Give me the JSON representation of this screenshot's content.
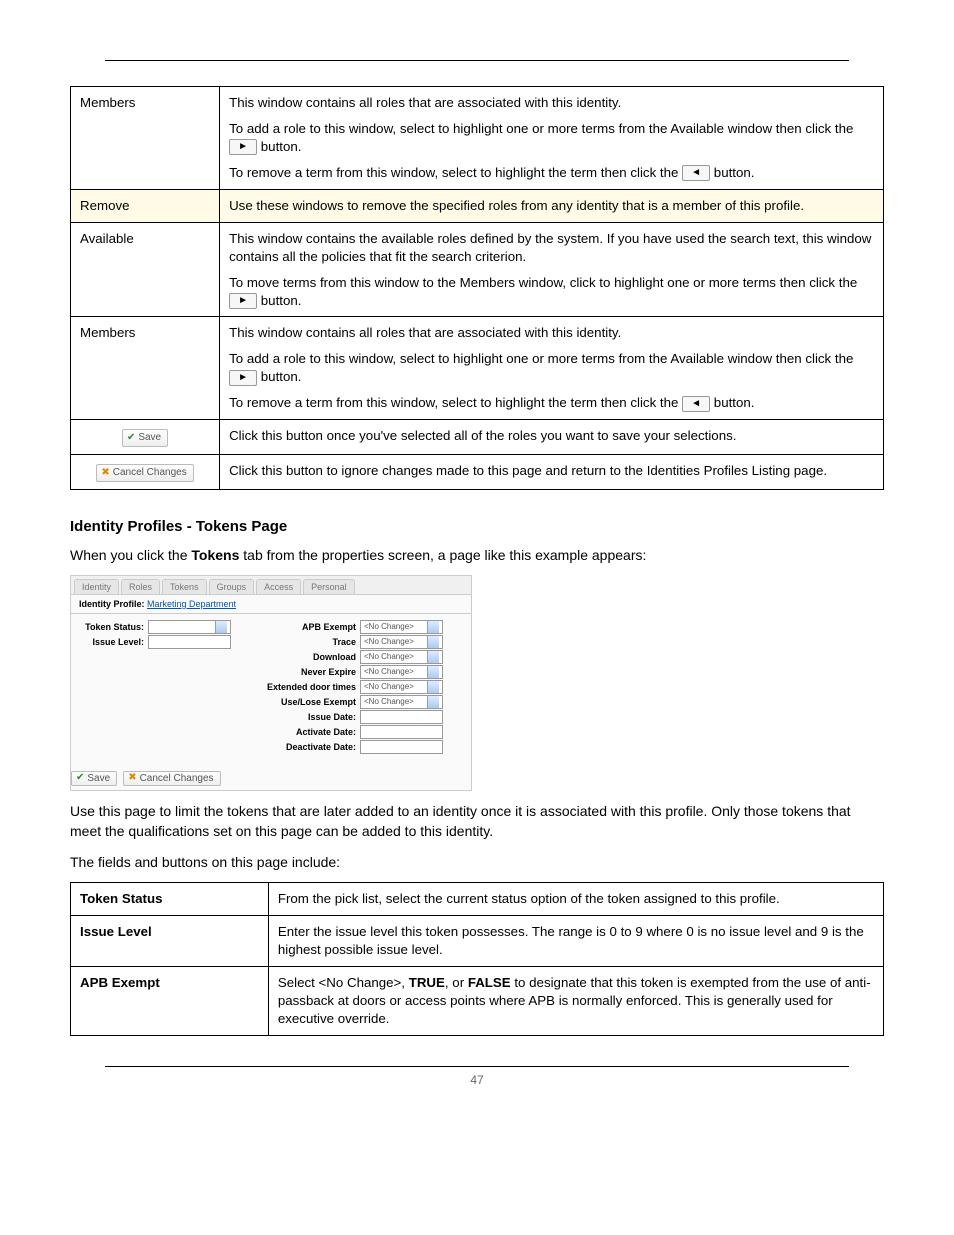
{
  "page_number": "47",
  "table1": {
    "rows": [
      {
        "label": "Members",
        "paras": [
          "This window contains all roles that are associated with this identity.",
          "To add a role to this window, select to highlight one or more terms from the Available window then click the {BTN_R} button.",
          "To remove a term from this window, select to highlight the term then click the {BTN_L} button."
        ]
      },
      {
        "label": "Remove",
        "highlight": true,
        "paras": [
          "Use these windows to remove the specified roles from any identity that is a member of this profile."
        ]
      },
      {
        "label": "Available",
        "paras": [
          "This window contains the available roles defined by the system. If you have used the search text, this window contains all the policies that fit the search criterion.",
          "To move terms from this window to the Members window, click to highlight one or more terms then click the {BTN_R} button."
        ]
      },
      {
        "label": "Members",
        "paras": [
          "This window contains all roles that are associated with this identity.",
          "To add a role to this window, select to highlight one or more terms from the Available window then click the {BTN_R} button.",
          "To remove a term from this window, select to highlight the term then click the {BTN_L} button."
        ]
      },
      {
        "button": "save",
        "btn_label": "Save",
        "paras": [
          "Click this button once you've selected all of the roles you want to save your selections."
        ]
      },
      {
        "button": "cancel",
        "btn_label": "Cancel Changes",
        "paras": [
          "Click this button to ignore changes made to this page and return to the Identities Profiles Listing page."
        ]
      }
    ]
  },
  "section_title": "Identity Profiles - Tokens Page",
  "section_intro_pre": "When you click the ",
  "section_intro_bold": "Tokens",
  "section_intro_post": " tab from the properties screen, a page like this example appears:",
  "mock": {
    "tabs": [
      "Identity",
      "Roles",
      "Tokens",
      "Groups",
      "Access",
      "Personal"
    ],
    "header_label": "Identity Profile: ",
    "header_link": "Marketing Department",
    "rows_left": [
      {
        "label": "Token Status:",
        "value": "",
        "select": true
      },
      {
        "label": "Issue Level:",
        "value": "",
        "select": false
      }
    ],
    "rows_right": [
      {
        "label": "APB Exempt",
        "value": "<No Change>",
        "select": true
      },
      {
        "label": "Trace",
        "value": "<No Change>",
        "select": true
      },
      {
        "label": "Download",
        "value": "<No Change>",
        "select": true
      },
      {
        "label": "Never Expire",
        "value": "<No Change>",
        "select": true
      },
      {
        "label": "Extended door times",
        "value": "<No Change>",
        "select": true
      },
      {
        "label": "Use/Lose Exempt",
        "value": "<No Change>",
        "select": true
      },
      {
        "label": "Issue Date:",
        "value": "",
        "select": false
      },
      {
        "label": "Activate Date:",
        "value": "",
        "select": false
      },
      {
        "label": "Deactivate Date:",
        "value": "",
        "select": false
      }
    ],
    "footer_save": "Save",
    "footer_cancel": "Cancel Changes"
  },
  "section_para1": "Use this page to limit the tokens that are later added to an identity once it is associated with this profile. Only those tokens that meet the qualifications set on this page can be added to this identity.",
  "section_para2": "The fields and buttons on this page include:",
  "table2": {
    "rows": [
      {
        "label": "Token Status",
        "desc_plain": "From the pick list, select the current status option of the token assigned to this profile."
      },
      {
        "label": "Issue Level",
        "desc_plain": "Enter the issue level this token possesses. The range is 0 to 9 where 0 is no issue level and 9 is the highest possible issue level."
      },
      {
        "label": "APB Exempt",
        "desc_html": "Select &lt;No Change&gt;, <b>TRUE</b>, or <b>FALSE</b> to designate that this token is exempted from the use of anti-passback at doors or access points where APB is normally enforced. This is generally used for executive override."
      }
    ]
  }
}
